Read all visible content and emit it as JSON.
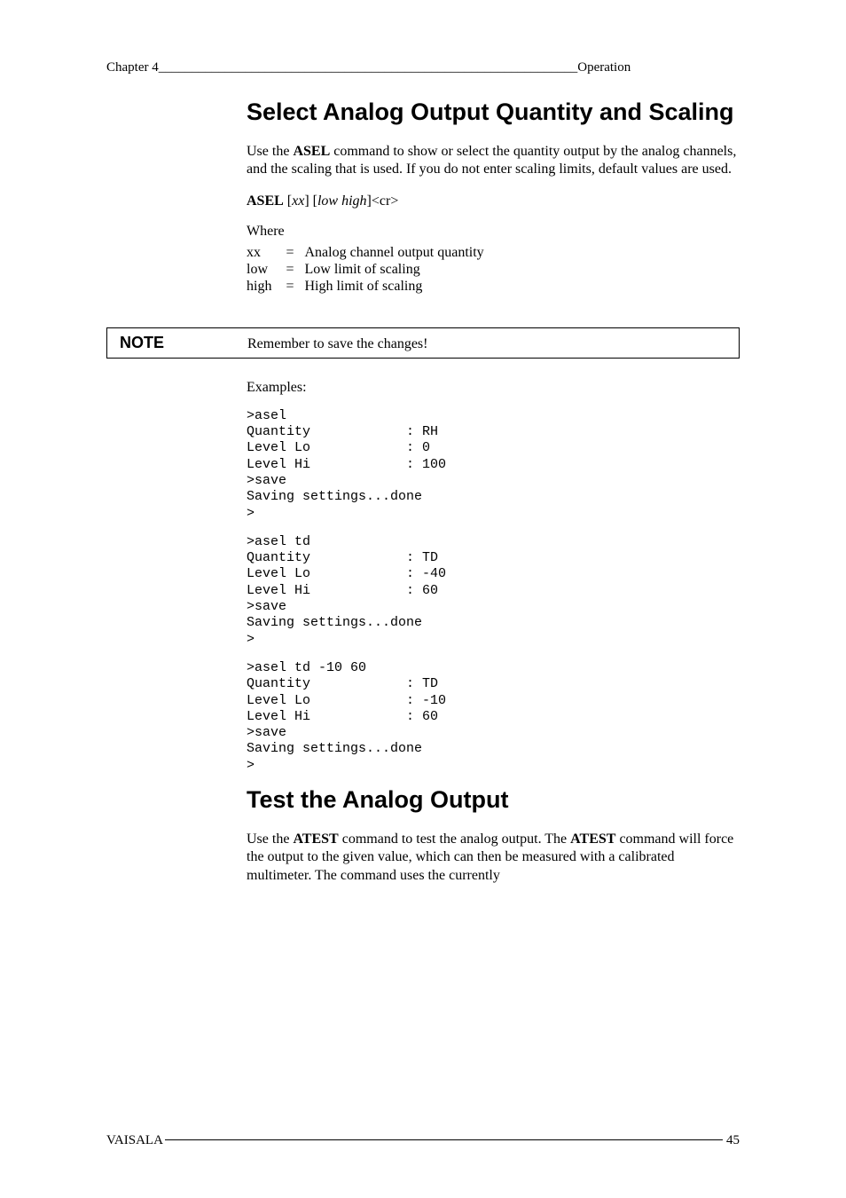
{
  "header": {
    "left": "Chapter 4",
    "right": "Operation"
  },
  "section1": {
    "title": "Select Analog Output Quantity and Scaling",
    "intro": "Use the <b>ASEL</b> command to show or select the quantity output by the analog channels, and the scaling that is used. If you do not enter scaling limits, default values are used.",
    "syntax": "<b>ASEL</b> [<i>xx</i>] [<i>low high</i>]&lt;cr&gt;",
    "where_label": "Where",
    "where": [
      {
        "sym": "xx",
        "desc": "Analog channel output quantity"
      },
      {
        "sym": "low",
        "desc": "Low limit of scaling"
      },
      {
        "sym": "high",
        "desc": "High limit of scaling"
      }
    ]
  },
  "note": {
    "label": "NOTE",
    "text": "Remember to save the changes!"
  },
  "examples": {
    "label": "Examples:",
    "block1": ">asel\nQuantity            : RH\nLevel Lo            : 0\nLevel Hi            : 100\n>save\nSaving settings...done\n>",
    "block2": ">asel td\nQuantity            : TD\nLevel Lo            : -40\nLevel Hi            : 60\n>save\nSaving settings...done\n>",
    "block3": ">asel td -10 60\nQuantity            : TD\nLevel Lo            : -10\nLevel Hi            : 60\n>save\nSaving settings...done\n>"
  },
  "section2": {
    "title": "Test the Analog Output",
    "intro": "Use the <b>ATEST</b> command to test the analog output. The <b>ATEST</b> command will force the output to the given value, which can then be measured with a calibrated multimeter. The command uses the currently"
  },
  "footer": {
    "left": "VAISALA",
    "right": "45"
  }
}
